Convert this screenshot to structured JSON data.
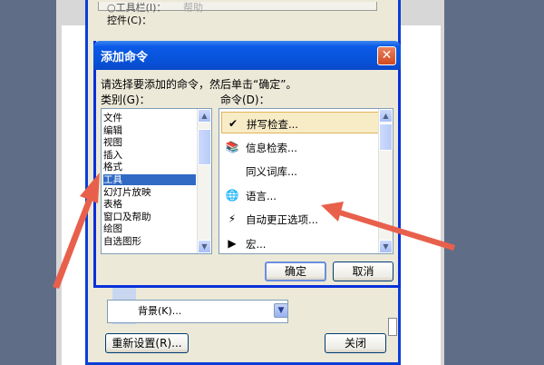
{
  "back_dialog": {
    "title_fragment": "○工具栏(I)：",
    "faded_fragment": "帮助",
    "controls_label": "控件(C)：",
    "background_label": "背景(K)...",
    "reset_button": "重新设置(R)...",
    "close_button": "关闭"
  },
  "dialog": {
    "title": "添加命令",
    "instruction": "请选择要添加的命令，然后单击“确定”。",
    "category_label": "类别(G)：",
    "command_label": "命令(D)：",
    "categories": [
      "文件",
      "编辑",
      "视图",
      "插入",
      "格式",
      "工具",
      "幻灯片放映",
      "表格",
      "窗口及帮助",
      "绘图",
      "自选图形"
    ],
    "selected_category": "工具",
    "commands": [
      {
        "label": "拼写检查...",
        "icon": "spellcheck-icon",
        "glyph": "✔"
      },
      {
        "label": "信息检索...",
        "icon": "research-icon",
        "glyph": "📚"
      },
      {
        "label": "同义词库...",
        "icon": "",
        "glyph": ""
      },
      {
        "label": "语言...",
        "icon": "language-icon",
        "glyph": "🌐"
      },
      {
        "label": "自动更正选项...",
        "icon": "autocorrect-icon",
        "glyph": "⚡"
      },
      {
        "label": "宏...",
        "icon": "macro-icon",
        "glyph": "▶"
      }
    ],
    "selected_command": "拼写检查...",
    "ok_button": "确定",
    "cancel_button": "取消",
    "close_glyph": "✕"
  },
  "colors": {
    "titlebar": "#0a5ae8",
    "selection": "#316ac5",
    "annotation_arrow": "#e8604c"
  }
}
